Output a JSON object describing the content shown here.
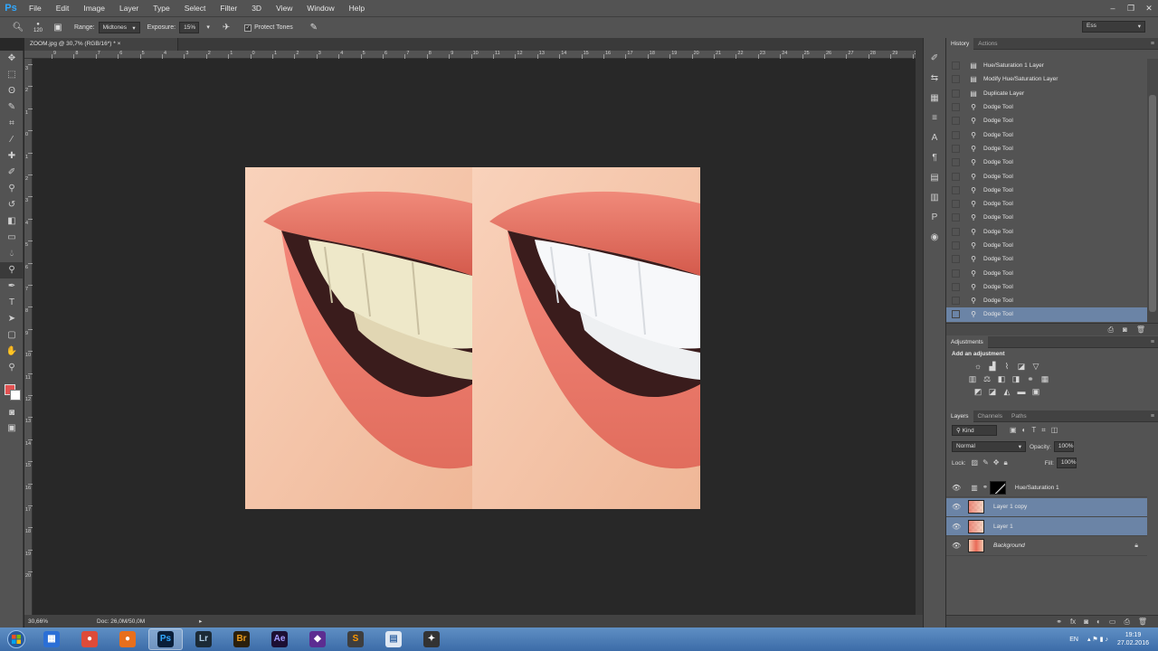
{
  "app": {
    "logo": "Ps"
  },
  "menu": [
    "File",
    "Edit",
    "Image",
    "Layer",
    "Type",
    "Select",
    "Filter",
    "3D",
    "View",
    "Window",
    "Help"
  ],
  "window_controls": {
    "minimize": "–",
    "restore": "❐",
    "close": "✕"
  },
  "options": {
    "brush_size": "120",
    "range_label": "Range:",
    "range_value": "Midtones",
    "exposure_label": "Exposure:",
    "exposure_value": "15%",
    "protect_tones_label": "Protect Tones",
    "workspace": "Ess"
  },
  "document": {
    "tab_title": "ZOOM.jpg @ 30,7% (RGB/16*) *",
    "tab_close": "×",
    "zoom": "30,66%",
    "doc_size": "Doc: 26,0M/50,0M",
    "ruler_top_numbers": [
      "9",
      "8",
      "7",
      "6",
      "5",
      "4",
      "3",
      "2",
      "1",
      "0",
      "1",
      "2",
      "3",
      "4",
      "5",
      "6",
      "7",
      "8",
      "9",
      "10",
      "11",
      "12",
      "13",
      "14",
      "15",
      "16",
      "17",
      "18",
      "19",
      "20",
      "21",
      "22",
      "23",
      "24",
      "25",
      "26",
      "27",
      "28",
      "29",
      "30"
    ],
    "ruler_left_numbers": [
      "3",
      "2",
      "1",
      "0",
      "1",
      "2",
      "3",
      "4",
      "5",
      "6",
      "7",
      "8",
      "9",
      "10",
      "11",
      "12",
      "13",
      "14",
      "15",
      "16",
      "17",
      "18",
      "19",
      "20"
    ]
  },
  "history": {
    "tabs": [
      "History",
      "Actions"
    ],
    "items": [
      {
        "label": "Hue/Saturation 1 Layer",
        "icon": "layer-icon"
      },
      {
        "label": "Modify Hue/Saturation Layer",
        "icon": "layer-icon"
      },
      {
        "label": "Duplicate Layer",
        "icon": "layer-icon"
      },
      {
        "label": "Dodge Tool",
        "icon": "dodge-tool-icon"
      },
      {
        "label": "Dodge Tool",
        "icon": "dodge-tool-icon"
      },
      {
        "label": "Dodge Tool",
        "icon": "dodge-tool-icon"
      },
      {
        "label": "Dodge Tool",
        "icon": "dodge-tool-icon"
      },
      {
        "label": "Dodge Tool",
        "icon": "dodge-tool-icon"
      },
      {
        "label": "Dodge Tool",
        "icon": "dodge-tool-icon"
      },
      {
        "label": "Dodge Tool",
        "icon": "dodge-tool-icon"
      },
      {
        "label": "Dodge Tool",
        "icon": "dodge-tool-icon"
      },
      {
        "label": "Dodge Tool",
        "icon": "dodge-tool-icon"
      },
      {
        "label": "Dodge Tool",
        "icon": "dodge-tool-icon"
      },
      {
        "label": "Dodge Tool",
        "icon": "dodge-tool-icon"
      },
      {
        "label": "Dodge Tool",
        "icon": "dodge-tool-icon"
      },
      {
        "label": "Dodge Tool",
        "icon": "dodge-tool-icon"
      },
      {
        "label": "Dodge Tool",
        "icon": "dodge-tool-icon"
      },
      {
        "label": "Dodge Tool",
        "icon": "dodge-tool-icon"
      },
      {
        "label": "Dodge Tool",
        "icon": "dodge-tool-icon"
      }
    ],
    "selected_index": 18
  },
  "adjustments": {
    "tab": "Adjustments",
    "title": "Add an adjustment"
  },
  "layers": {
    "tabs": [
      "Layers",
      "Channels",
      "Paths"
    ],
    "kind_filter": "Kind",
    "blend_mode": "Normal",
    "opacity_label": "Opacity:",
    "opacity_value": "100%",
    "lock_label": "Lock:",
    "fill_label": "Fill:",
    "fill_value": "100%",
    "items": [
      {
        "name": "Hue/Saturation 1",
        "selected": false,
        "type": "adjustment"
      },
      {
        "name": "Layer 1 copy",
        "selected": true,
        "type": "pixel"
      },
      {
        "name": "Layer 1",
        "selected": true,
        "type": "pixel"
      },
      {
        "name": "Background",
        "selected": false,
        "type": "background",
        "italic": true
      }
    ]
  },
  "taskbar": {
    "apps": [
      {
        "name": "start-button"
      },
      {
        "name": "file-explorer",
        "glyph": "▦",
        "color": "#2b6fd6"
      },
      {
        "name": "chrome",
        "glyph": "●",
        "color": "#de4b39"
      },
      {
        "name": "firefox",
        "glyph": "●",
        "color": "#e76f1c"
      },
      {
        "name": "photoshop",
        "glyph": "Ps",
        "color": "#0a1f3a",
        "text": "#31a8ff",
        "active": true
      },
      {
        "name": "lightroom",
        "glyph": "Lr",
        "color": "#1b2a36",
        "text": "#adcbe3"
      },
      {
        "name": "bridge",
        "glyph": "Br",
        "color": "#2a1f0c",
        "text": "#e89b1d"
      },
      {
        "name": "after-effects",
        "glyph": "Ae",
        "color": "#1c0f33",
        "text": "#a49bff"
      },
      {
        "name": "visual-studio",
        "glyph": "◆",
        "color": "#5c2d91",
        "text": "#ffffff"
      },
      {
        "name": "sublime",
        "glyph": "S",
        "color": "#3e3e3e",
        "text": "#ff9800"
      },
      {
        "name": "notepad",
        "glyph": "▤",
        "color": "#dfe8f3",
        "text": "#3c6ca8"
      },
      {
        "name": "app-tool",
        "glyph": "✦",
        "color": "#333333",
        "text": "#ffffff"
      }
    ],
    "language": "EN",
    "time": "19:19",
    "date": "27.02.2016"
  },
  "colors": {
    "fg": "#e25252",
    "bg": "#ffffff",
    "selection": "#6b84a6"
  }
}
